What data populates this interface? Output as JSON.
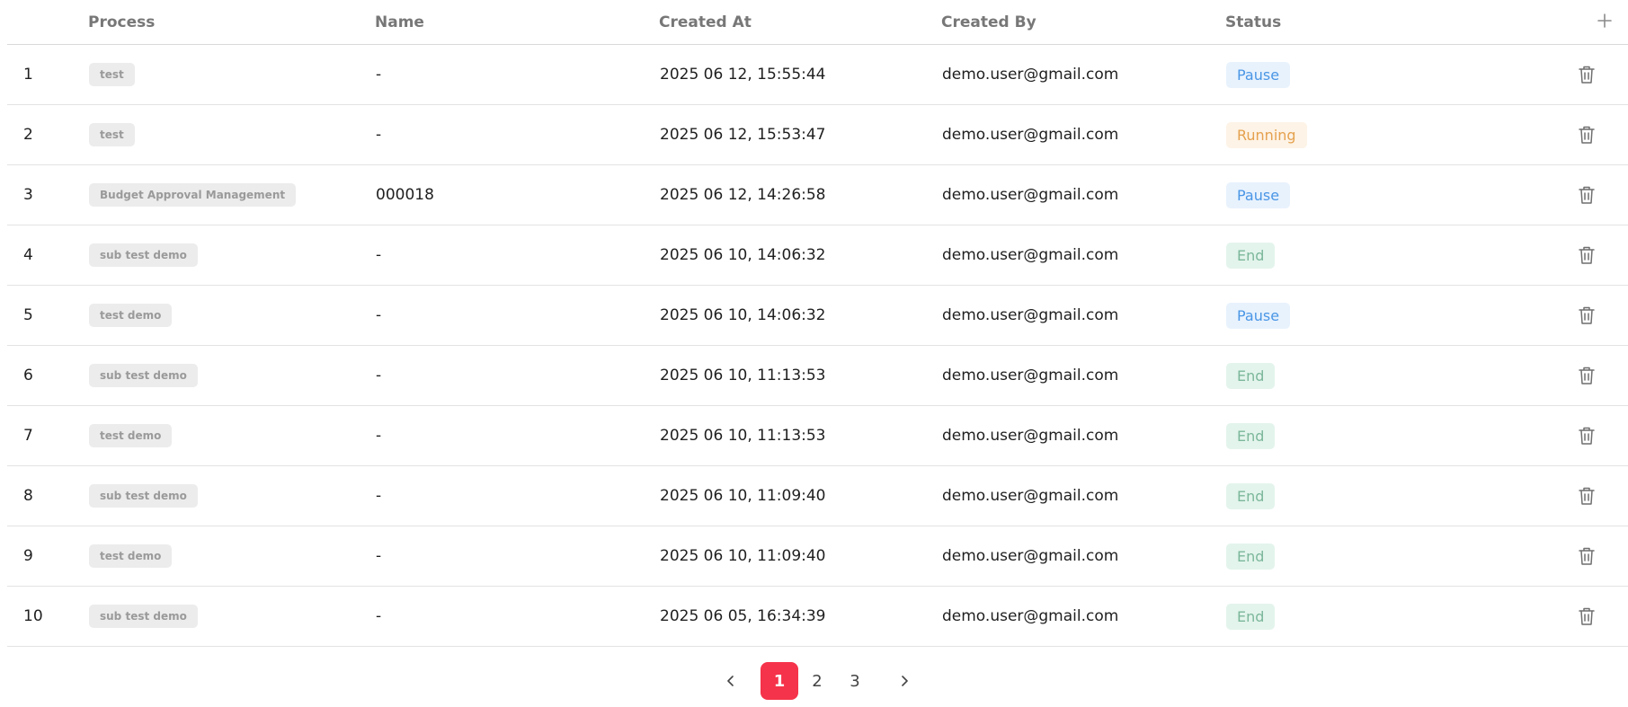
{
  "table": {
    "headers": {
      "process": "Process",
      "name": "Name",
      "created_at": "Created At",
      "created_by": "Created By",
      "status": "Status"
    },
    "add_icon": "plus-icon",
    "delete_icon": "trash-icon",
    "rows": [
      {
        "index": "1",
        "process": "test",
        "name": "-",
        "created_at": "2025 06 12, 15:55:44",
        "created_by": "demo.user@gmail.com",
        "status": "Pause"
      },
      {
        "index": "2",
        "process": "test",
        "name": "-",
        "created_at": "2025 06 12, 15:53:47",
        "created_by": "demo.user@gmail.com",
        "status": "Running"
      },
      {
        "index": "3",
        "process": "Budget Approval Management",
        "name": "000018",
        "created_at": "2025 06 12, 14:26:58",
        "created_by": "demo.user@gmail.com",
        "status": "Pause"
      },
      {
        "index": "4",
        "process": "sub test demo",
        "name": "-",
        "created_at": "2025 06 10, 14:06:32",
        "created_by": "demo.user@gmail.com",
        "status": "End"
      },
      {
        "index": "5",
        "process": "test demo",
        "name": "-",
        "created_at": "2025 06 10, 14:06:32",
        "created_by": "demo.user@gmail.com",
        "status": "Pause"
      },
      {
        "index": "6",
        "process": "sub test demo",
        "name": "-",
        "created_at": "2025 06 10, 11:13:53",
        "created_by": "demo.user@gmail.com",
        "status": "End"
      },
      {
        "index": "7",
        "process": "test demo",
        "name": "-",
        "created_at": "2025 06 10, 11:13:53",
        "created_by": "demo.user@gmail.com",
        "status": "End"
      },
      {
        "index": "8",
        "process": "sub test demo",
        "name": "-",
        "created_at": "2025 06 10, 11:09:40",
        "created_by": "demo.user@gmail.com",
        "status": "End"
      },
      {
        "index": "9",
        "process": "test demo",
        "name": "-",
        "created_at": "2025 06 10, 11:09:40",
        "created_by": "demo.user@gmail.com",
        "status": "End"
      },
      {
        "index": "10",
        "process": "sub test demo",
        "name": "-",
        "created_at": "2025 06 05, 16:34:39",
        "created_by": "demo.user@gmail.com",
        "status": "End"
      }
    ]
  },
  "pagination": {
    "prev_icon": "chevron-left-icon",
    "next_icon": "chevron-right-icon",
    "pages": [
      "1",
      "2",
      "3"
    ],
    "current": "1"
  },
  "colors": {
    "pause": "#4a96e6",
    "running": "#e5a14e",
    "end": "#7bb79a",
    "active_page": "#f5334a"
  }
}
